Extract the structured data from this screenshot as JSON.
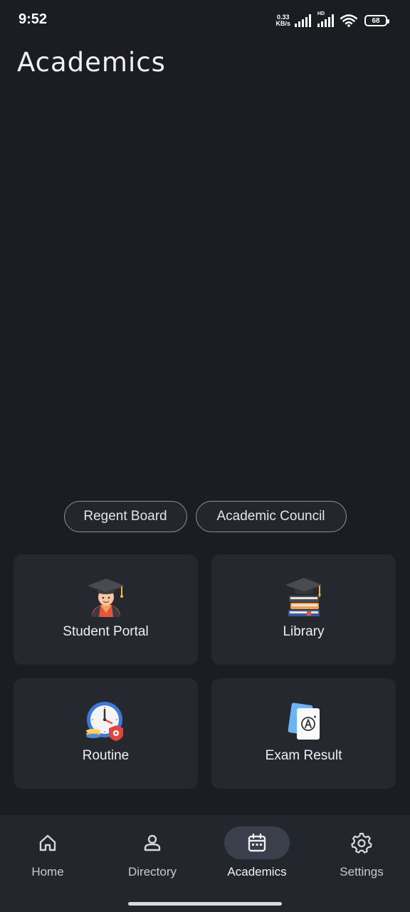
{
  "status_bar": {
    "time": "9:52",
    "net_speed_value": "0.33",
    "net_speed_unit": "KB/s",
    "hd_label": "HD",
    "battery": "68"
  },
  "page": {
    "title": "Academics"
  },
  "chips": [
    {
      "label": "Regent Board"
    },
    {
      "label": "Academic Council"
    }
  ],
  "cards": [
    {
      "label": "Student Portal",
      "icon": "graduate-student-icon"
    },
    {
      "label": "Library",
      "icon": "books-graduation-cap-icon"
    },
    {
      "label": "Routine",
      "icon": "clock-schedule-icon"
    },
    {
      "label": "Exam Result",
      "icon": "exam-grade-paper-icon"
    }
  ],
  "bottom_nav": {
    "items": [
      {
        "label": "Home",
        "icon": "home-icon"
      },
      {
        "label": "Directory",
        "icon": "person-icon"
      },
      {
        "label": "Academics",
        "icon": "calendar-icon",
        "active": true
      },
      {
        "label": "Settings",
        "icon": "gear-icon"
      }
    ]
  },
  "colors": {
    "background": "#1c1d22",
    "card": "#262830",
    "nav_background": "#24262d",
    "nav_active_pill": "#3b3e4b"
  }
}
